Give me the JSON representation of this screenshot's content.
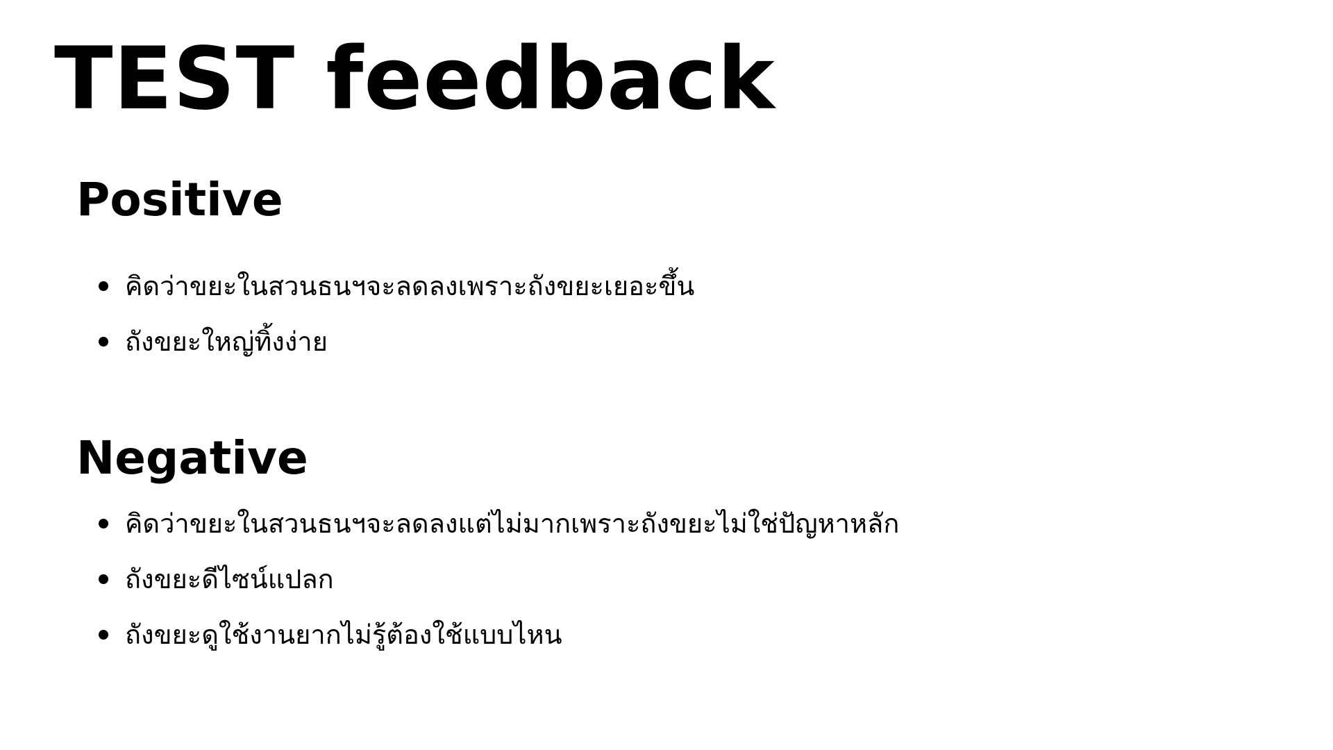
{
  "slide": {
    "title": "TEST feedback",
    "sections": {
      "positive": {
        "heading": "Positive",
        "items": [
          "คิดว่าขยะในสวนธนฯจะลดลงเพราะถังขยะเยอะขึ้น",
          "ถังขยะใหญ่ทิ้งง่าย"
        ]
      },
      "negative": {
        "heading": "Negative",
        "items": [
          "คิดว่าขยะในสวนธนฯจะลดลงแต่ไม่มากเพราะถังขยะไม่ใช่ปัญหาหลัก",
          "ถังขยะดีไซน์แปลก",
          "ถังขยะดูใช้งานยากไม่รู้ต้องใช้แบบไหน"
        ]
      }
    },
    "colors": {
      "background": "#ffffff",
      "text": "#000000"
    }
  }
}
